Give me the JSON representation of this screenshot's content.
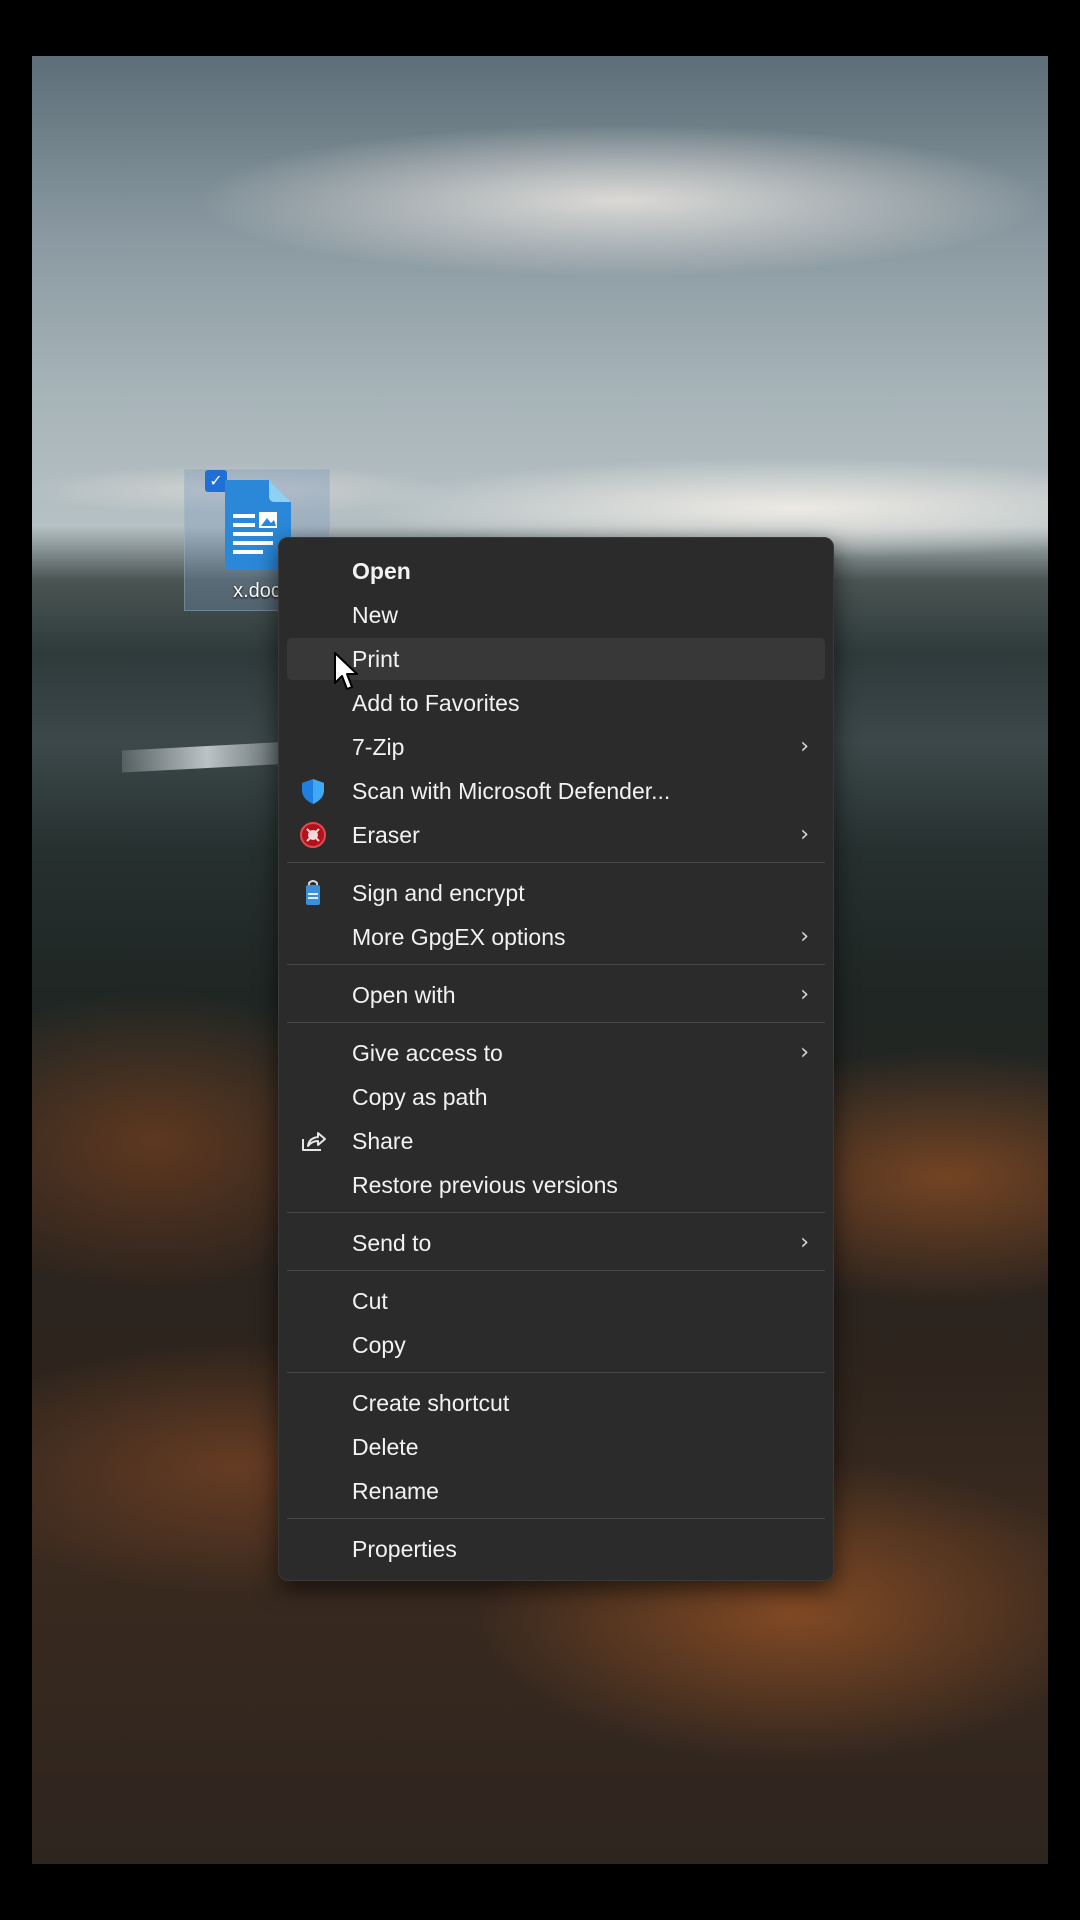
{
  "desktop": {
    "file_icon": {
      "label": "x.doc",
      "icon": "word-document-icon",
      "selected": true
    }
  },
  "context_menu": {
    "items": [
      {
        "label": "Open",
        "bold": true
      },
      {
        "label": "New"
      },
      {
        "label": "Print",
        "hovered": true
      },
      {
        "label": "Add to Favorites"
      },
      {
        "label": "7-Zip",
        "submenu": true
      },
      {
        "label": "Scan with Microsoft Defender...",
        "icon": "defender-shield-icon"
      },
      {
        "label": "Eraser",
        "icon": "eraser-icon",
        "submenu": true
      },
      {
        "label": "Sign and encrypt",
        "icon": "lock-file-icon"
      },
      {
        "label": "More GpgEX options",
        "submenu": true
      },
      {
        "label": "Open with",
        "submenu": true
      },
      {
        "label": "Give access to",
        "submenu": true
      },
      {
        "label": "Copy as path"
      },
      {
        "label": "Share",
        "icon": "share-icon"
      },
      {
        "label": "Restore previous versions"
      },
      {
        "label": "Send to",
        "submenu": true
      },
      {
        "label": "Cut"
      },
      {
        "label": "Copy"
      },
      {
        "label": "Create shortcut"
      },
      {
        "label": "Delete"
      },
      {
        "label": "Rename"
      },
      {
        "label": "Properties"
      }
    ],
    "chevron_glyph": "›"
  },
  "colors": {
    "menu_background": "#2b2b2b",
    "menu_hover": "#383838",
    "menu_text": "#f2f2f2",
    "selection_check": "#1f6fd6",
    "document_blue": "#2b88d8"
  }
}
